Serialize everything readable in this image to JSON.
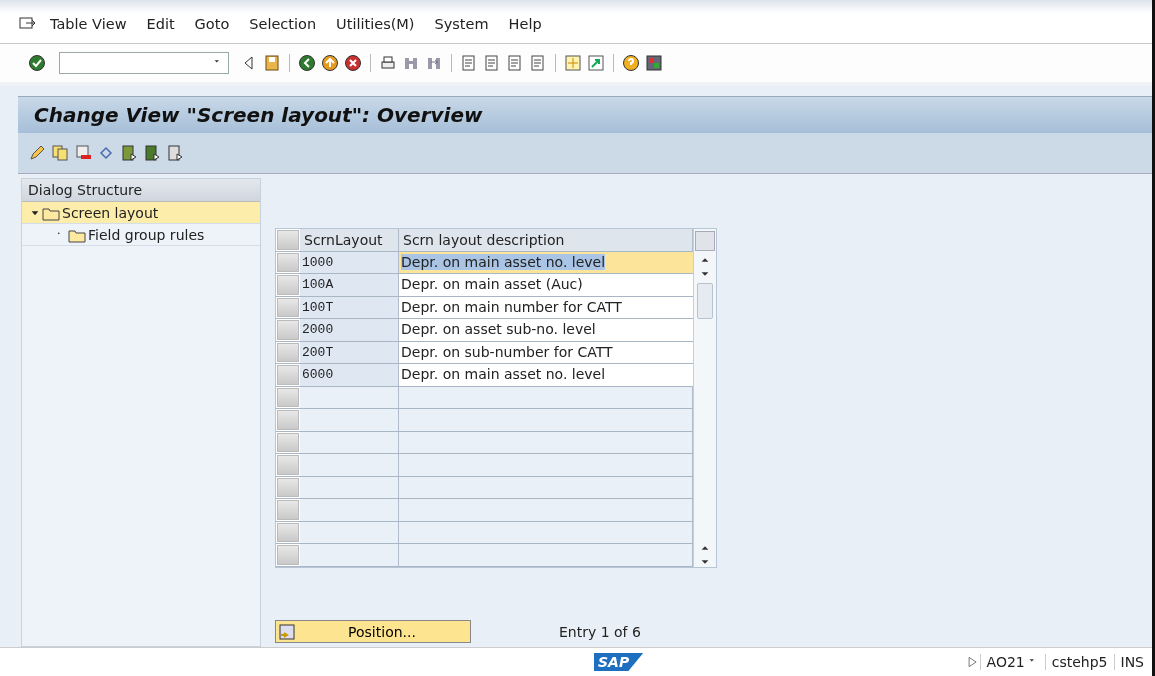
{
  "menu_bar": [
    {
      "label": "Table View"
    },
    {
      "label": "Edit"
    },
    {
      "label": "Goto"
    },
    {
      "label": "Selection"
    },
    {
      "label": "Utilities(M)"
    },
    {
      "label": "System"
    },
    {
      "label": "Help"
    }
  ],
  "title": "Change View \"Screen layout\": Overview",
  "dialog_structure": {
    "title": "Dialog Structure",
    "items": [
      {
        "label": "Screen layout",
        "expanded": true,
        "selected": true,
        "children": [
          {
            "label": "Field group rules",
            "selected": false
          }
        ]
      }
    ]
  },
  "table": {
    "columns": [
      "ScrnLayout",
      "Scrn layout description"
    ],
    "rows": [
      {
        "code": "1000",
        "description": "Depr. on main asset no. level",
        "selected": true
      },
      {
        "code": "100A",
        "description": "Depr. on main asset (Auc)",
        "selected": false
      },
      {
        "code": "100T",
        "description": "Depr. on main number for CATT",
        "selected": false
      },
      {
        "code": "2000",
        "description": "Depr. on asset sub-no. level",
        "selected": false
      },
      {
        "code": "200T",
        "description": "Depr. on sub-number for CATT",
        "selected": false
      },
      {
        "code": "6000",
        "description": "Depr. on main asset no. level",
        "selected": false
      }
    ]
  },
  "position_button": "Position...",
  "entry_info": "Entry 1 of 6",
  "status_bar": {
    "logo": "SAP",
    "transaction": "AO21",
    "system": "cstehp5",
    "mode": "INS"
  }
}
